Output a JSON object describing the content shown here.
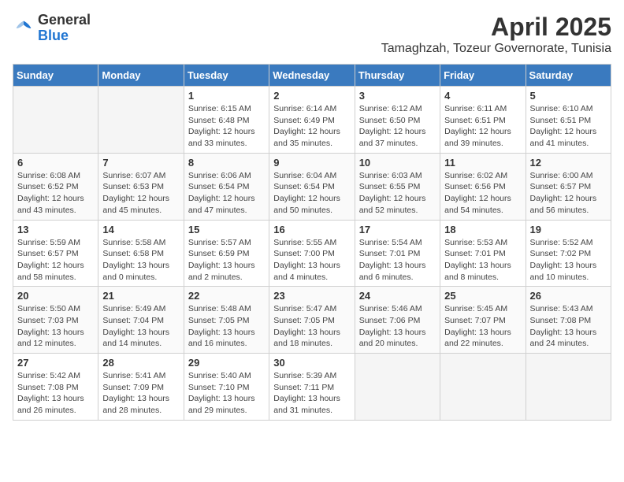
{
  "header": {
    "logo_general": "General",
    "logo_blue": "Blue",
    "month_year": "April 2025",
    "location": "Tamaghzah, Tozeur Governorate, Tunisia"
  },
  "days_of_week": [
    "Sunday",
    "Monday",
    "Tuesday",
    "Wednesday",
    "Thursday",
    "Friday",
    "Saturday"
  ],
  "weeks": [
    [
      {
        "day": "",
        "empty": true
      },
      {
        "day": "",
        "empty": true
      },
      {
        "day": "1",
        "sunrise": "6:15 AM",
        "sunset": "6:48 PM",
        "daylight": "12 hours and 33 minutes."
      },
      {
        "day": "2",
        "sunrise": "6:14 AM",
        "sunset": "6:49 PM",
        "daylight": "12 hours and 35 minutes."
      },
      {
        "day": "3",
        "sunrise": "6:12 AM",
        "sunset": "6:50 PM",
        "daylight": "12 hours and 37 minutes."
      },
      {
        "day": "4",
        "sunrise": "6:11 AM",
        "sunset": "6:51 PM",
        "daylight": "12 hours and 39 minutes."
      },
      {
        "day": "5",
        "sunrise": "6:10 AM",
        "sunset": "6:51 PM",
        "daylight": "12 hours and 41 minutes."
      }
    ],
    [
      {
        "day": "6",
        "sunrise": "6:08 AM",
        "sunset": "6:52 PM",
        "daylight": "12 hours and 43 minutes."
      },
      {
        "day": "7",
        "sunrise": "6:07 AM",
        "sunset": "6:53 PM",
        "daylight": "12 hours and 45 minutes."
      },
      {
        "day": "8",
        "sunrise": "6:06 AM",
        "sunset": "6:54 PM",
        "daylight": "12 hours and 47 minutes."
      },
      {
        "day": "9",
        "sunrise": "6:04 AM",
        "sunset": "6:54 PM",
        "daylight": "12 hours and 50 minutes."
      },
      {
        "day": "10",
        "sunrise": "6:03 AM",
        "sunset": "6:55 PM",
        "daylight": "12 hours and 52 minutes."
      },
      {
        "day": "11",
        "sunrise": "6:02 AM",
        "sunset": "6:56 PM",
        "daylight": "12 hours and 54 minutes."
      },
      {
        "day": "12",
        "sunrise": "6:00 AM",
        "sunset": "6:57 PM",
        "daylight": "12 hours and 56 minutes."
      }
    ],
    [
      {
        "day": "13",
        "sunrise": "5:59 AM",
        "sunset": "6:57 PM",
        "daylight": "12 hours and 58 minutes."
      },
      {
        "day": "14",
        "sunrise": "5:58 AM",
        "sunset": "6:58 PM",
        "daylight": "13 hours and 0 minutes."
      },
      {
        "day": "15",
        "sunrise": "5:57 AM",
        "sunset": "6:59 PM",
        "daylight": "13 hours and 2 minutes."
      },
      {
        "day": "16",
        "sunrise": "5:55 AM",
        "sunset": "7:00 PM",
        "daylight": "13 hours and 4 minutes."
      },
      {
        "day": "17",
        "sunrise": "5:54 AM",
        "sunset": "7:01 PM",
        "daylight": "13 hours and 6 minutes."
      },
      {
        "day": "18",
        "sunrise": "5:53 AM",
        "sunset": "7:01 PM",
        "daylight": "13 hours and 8 minutes."
      },
      {
        "day": "19",
        "sunrise": "5:52 AM",
        "sunset": "7:02 PM",
        "daylight": "13 hours and 10 minutes."
      }
    ],
    [
      {
        "day": "20",
        "sunrise": "5:50 AM",
        "sunset": "7:03 PM",
        "daylight": "13 hours and 12 minutes."
      },
      {
        "day": "21",
        "sunrise": "5:49 AM",
        "sunset": "7:04 PM",
        "daylight": "13 hours and 14 minutes."
      },
      {
        "day": "22",
        "sunrise": "5:48 AM",
        "sunset": "7:05 PM",
        "daylight": "13 hours and 16 minutes."
      },
      {
        "day": "23",
        "sunrise": "5:47 AM",
        "sunset": "7:05 PM",
        "daylight": "13 hours and 18 minutes."
      },
      {
        "day": "24",
        "sunrise": "5:46 AM",
        "sunset": "7:06 PM",
        "daylight": "13 hours and 20 minutes."
      },
      {
        "day": "25",
        "sunrise": "5:45 AM",
        "sunset": "7:07 PM",
        "daylight": "13 hours and 22 minutes."
      },
      {
        "day": "26",
        "sunrise": "5:43 AM",
        "sunset": "7:08 PM",
        "daylight": "13 hours and 24 minutes."
      }
    ],
    [
      {
        "day": "27",
        "sunrise": "5:42 AM",
        "sunset": "7:08 PM",
        "daylight": "13 hours and 26 minutes."
      },
      {
        "day": "28",
        "sunrise": "5:41 AM",
        "sunset": "7:09 PM",
        "daylight": "13 hours and 28 minutes."
      },
      {
        "day": "29",
        "sunrise": "5:40 AM",
        "sunset": "7:10 PM",
        "daylight": "13 hours and 29 minutes."
      },
      {
        "day": "30",
        "sunrise": "5:39 AM",
        "sunset": "7:11 PM",
        "daylight": "13 hours and 31 minutes."
      },
      {
        "day": "",
        "empty": true
      },
      {
        "day": "",
        "empty": true
      },
      {
        "day": "",
        "empty": true
      }
    ]
  ]
}
